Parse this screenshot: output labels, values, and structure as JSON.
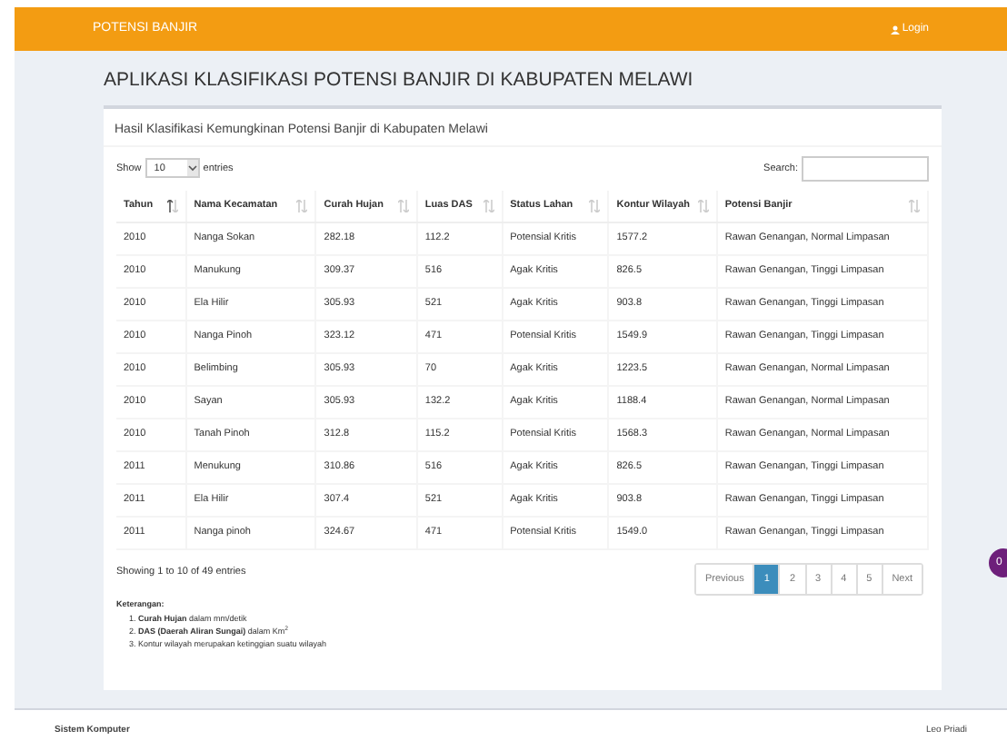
{
  "navbar": {
    "brand": "POTENSI BANJIR",
    "login": "Login"
  },
  "page_title": "APLIKASI KLASIFIKASI POTENSI BANJIR DI KABUPATEN MELAWI",
  "card": {
    "title": "Hasil Klasifikasi Kemungkinan Potensi Banjir di Kabupaten Melawi",
    "length_control": {
      "show": "Show",
      "value": "10",
      "entries": "entries"
    },
    "search": {
      "label": "Search:"
    },
    "table": {
      "columns": [
        {
          "label": "Tahun",
          "sorted": true
        },
        {
          "label": "Nama Kecamatan",
          "sorted": false
        },
        {
          "label": "Curah Hujan",
          "sorted": false
        },
        {
          "label": "Luas DAS",
          "sorted": false
        },
        {
          "label": "Status Lahan",
          "sorted": false
        },
        {
          "label": "Kontur Wilayah",
          "sorted": false
        },
        {
          "label": "Potensi Banjir",
          "sorted": false
        }
      ],
      "rows": [
        [
          "2010",
          "Nanga Sokan",
          "282.18",
          "112.2",
          "Potensial Kritis",
          "1577.2",
          "Rawan Genangan, Normal Limpasan"
        ],
        [
          "2010",
          "Manukung",
          "309.37",
          "516",
          "Agak Kritis",
          "826.5",
          "Rawan Genangan, Tinggi Limpasan"
        ],
        [
          "2010",
          "Ela Hilir",
          "305.93",
          "521",
          "Agak Kritis",
          "903.8",
          "Rawan Genangan, Tinggi Limpasan"
        ],
        [
          "2010",
          "Nanga Pinoh",
          "323.12",
          "471",
          "Potensial Kritis",
          "1549.9",
          "Rawan Genangan, Tinggi Limpasan"
        ],
        [
          "2010",
          "Belimbing",
          "305.93",
          "70",
          "Agak Kritis",
          "1223.5",
          "Rawan Genangan, Normal Limpasan"
        ],
        [
          "2010",
          "Sayan",
          "305.93",
          "132.2",
          "Agak Kritis",
          "1188.4",
          "Rawan Genangan, Normal Limpasan"
        ],
        [
          "2010",
          "Tanah Pinoh",
          "312.8",
          "115.2",
          "Potensial Kritis",
          "1568.3",
          "Rawan Genangan, Normal Limpasan"
        ],
        [
          "2011",
          "Menukung",
          "310.86",
          "516",
          "Agak Kritis",
          "826.5",
          "Rawan Genangan, Tinggi Limpasan"
        ],
        [
          "2011",
          "Ela Hilir",
          "307.4",
          "521",
          "Agak Kritis",
          "903.8",
          "Rawan Genangan, Tinggi Limpasan"
        ],
        [
          "2011",
          "Nanga pinoh",
          "324.67",
          "471",
          "Potensial Kritis",
          "1549.0",
          "Rawan Genangan, Tinggi Limpasan"
        ]
      ]
    },
    "info": "Showing 1 to 10 of 49 entries",
    "pagination": [
      {
        "label": "Previous",
        "selected": false
      },
      {
        "label": "1",
        "selected": true
      },
      {
        "label": "2",
        "selected": false
      },
      {
        "label": "3",
        "selected": false
      },
      {
        "label": "4",
        "selected": false
      },
      {
        "label": "5",
        "selected": false
      },
      {
        "label": "Next",
        "selected": false
      }
    ],
    "notes": {
      "title": "Keterangan:",
      "items": [
        "1. **Curah Hujan** dalam mm/detik",
        "2. **DAS (Daerah Aliran Sungai)** dalam Km$^{2}$",
        "3. Kontur wilayah merupakan ketinggian suatu wilayah"
      ]
    }
  },
  "badge": "0",
  "footer": {
    "left": "Sistem Komputer",
    "right": "Leo Priadi"
  }
}
